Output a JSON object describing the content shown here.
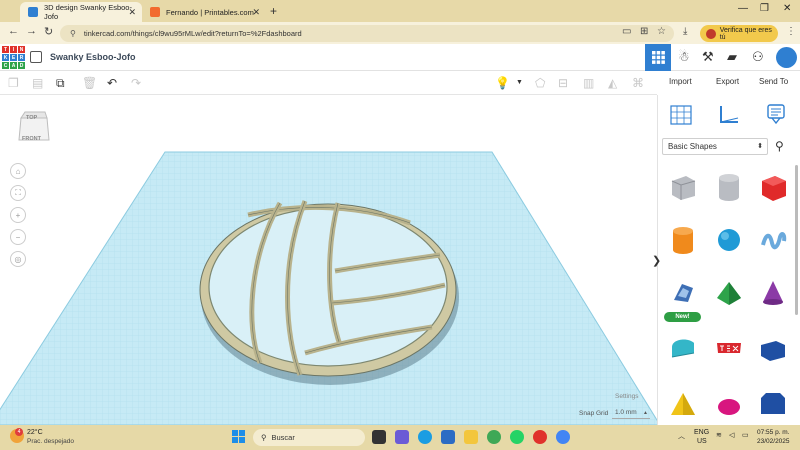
{
  "browser": {
    "tabs": [
      {
        "title": "3D design Swanky Esboo-Jofo",
        "active": true
      },
      {
        "title": "Fernando | Printables.com",
        "active": false
      }
    ],
    "url": "tinkercad.com/things/cl9wu95rMLw/edit?returnTo=%2Fdashboard",
    "verify_label": "Verifica que eres tú"
  },
  "app": {
    "logo_letters": [
      "TIN",
      "KER",
      "CAD"
    ],
    "project_title": "Swanky Esboo-Jofo",
    "actions": [
      "Import",
      "Export",
      "Send To"
    ]
  },
  "viewcube": {
    "top": "TOP",
    "front": "FRONT"
  },
  "workplane": {
    "settings_label": "Settings",
    "snap_grid_label": "Snap Grid",
    "snap_grid_value": "1.0 mm"
  },
  "panel": {
    "category": "Basic Shapes",
    "new_badge": "New!",
    "shapes": [
      {
        "name": "box-hole",
        "color": "#b9bcc2"
      },
      {
        "name": "cylinder-hole",
        "color": "#b9bcc2"
      },
      {
        "name": "box",
        "color": "#e02a2a"
      },
      {
        "name": "cylinder",
        "color": "#f08a1c"
      },
      {
        "name": "sphere",
        "color": "#1f9ad6"
      },
      {
        "name": "scribble",
        "color": "#6aa9dc"
      },
      {
        "name": "shape-generator",
        "color": "#3e6fb5"
      },
      {
        "name": "pyramid",
        "color": "#2ea34a"
      },
      {
        "name": "cone",
        "color": "#8b3aa6"
      },
      {
        "name": "roof",
        "color": "#34b6c8"
      },
      {
        "name": "text",
        "color": "#d9272e"
      },
      {
        "name": "wedge",
        "color": "#1f4fa3"
      },
      {
        "name": "pyramid-yellow",
        "color": "#f0c419"
      },
      {
        "name": "half-sphere",
        "color": "#d8167f"
      },
      {
        "name": "polygon",
        "color": "#1f4fa3"
      }
    ]
  },
  "colors": {
    "accent": "#2f7fd1",
    "workplane": "#bfe6f3",
    "model": "#c9c39b"
  },
  "taskbar": {
    "weather_badge": "4",
    "temperature": "22°C",
    "weather": "Prac. despejado",
    "search_label": "Buscar",
    "lang": "ENG",
    "region": "US",
    "time": "07:55 p. m.",
    "date": "23/02/2025"
  }
}
